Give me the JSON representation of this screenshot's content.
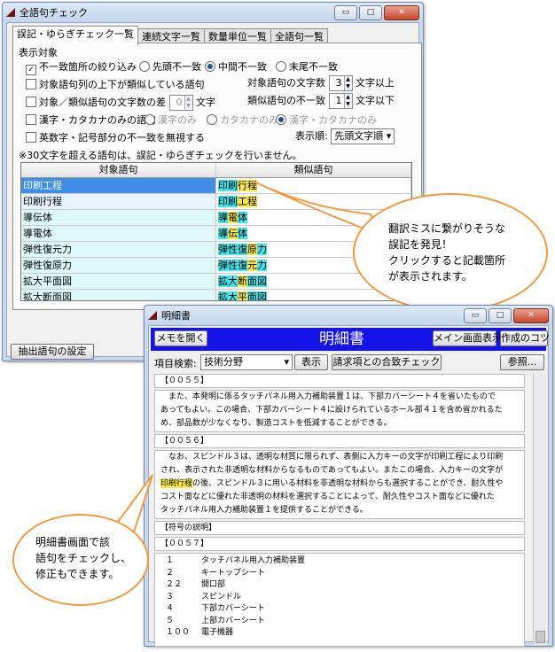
{
  "main_window": {
    "title": "全語句チェック",
    "tabs": [
      "誤記・ゆらぎチェック一覧",
      "連続文字一覧",
      "数量単位一覧",
      "全語句一覧"
    ],
    "group_label": "表示対象",
    "filter_mismatch_label": "不一致箇所の絞り込み",
    "filter_mismatch_checked": "✓",
    "radio_mismatch": [
      "先頭不一致",
      "中間不一致",
      "末尾不一致"
    ],
    "opt_similar_label": "対象語句列の上下が類似している語句",
    "opt_target_len_label": "対象語句の文字数",
    "target_len_value": "3",
    "target_len_suffix": "文字以上",
    "opt_length_diff_label": "対象／類似語句の文字数の差",
    "length_diff_value": "0",
    "length_diff_suffix": "文字",
    "opt_mismatch_count_label": "類似語句の不一致",
    "mismatch_count_value": "1",
    "mismatch_count_suffix": "文字以下",
    "opt_kanji_label": "漢字・カタカナのみの語句",
    "radio_kanji": [
      "漢字のみ",
      "カタカナのみ",
      "漢字・カタカナのみ"
    ],
    "opt_ignore_label": "英数字・記号部分の不一致を無視する",
    "sort_label": "表示順:",
    "sort_value": "先頭文字順",
    "notice": "※30文字を超える語句は、誤記・ゆらぎチェックを行いません。",
    "columns": [
      "対象語句",
      "類似語句"
    ],
    "rows": [
      {
        "target": "印刷工程",
        "sim_a": "印刷",
        "sim_b": "行程",
        "sim_c": ""
      },
      {
        "target": "印刷行程",
        "sim_a": "印刷",
        "sim_b": "工程",
        "sim_c": ""
      },
      {
        "target": "導伝体",
        "sim_a": "導",
        "sim_b": "電",
        "sim_c": "体"
      },
      {
        "target": "導電体",
        "sim_a": "導",
        "sim_b": "伝",
        "sim_c": "体"
      },
      {
        "target": "弾性復元力",
        "sim_a": "弾性復",
        "sim_b": "原",
        "sim_c": "力"
      },
      {
        "target": "弾性復原力",
        "sim_a": "弾性復",
        "sim_b": "元",
        "sim_c": "力"
      },
      {
        "target": "拡大平面図",
        "sim_a": "拡大",
        "sim_b": "断",
        "sim_c": "面図"
      },
      {
        "target": "拡大断面図",
        "sim_a": "拡大",
        "sim_b": "平",
        "sim_c": "面図"
      }
    ],
    "settings_button": "抽出語句の設定"
  },
  "callout_top": {
    "lines": [
      "翻訳ミスに繋がりそうな",
      "誤記を発見！",
      "クリックすると記載箇所",
      "が表示されます。"
    ]
  },
  "spec_window": {
    "title": "明細書",
    "memo_button": "メモを開く",
    "heading": "明細書",
    "main_button": "メイン画面表示",
    "tips_button": "作成のコツ",
    "search_label": "項目検索:",
    "search_value": "技術分野",
    "show_button": "表示",
    "claims_button": "請求項との合致チェック",
    "ref_button": "参照...",
    "sec1": "【００５５】",
    "para1": [
      "　また、本発明に係るタッチパネル用入力補助装置１は、下部カバーシート４を省いたもので",
      "あってもよい。この場合、下部カバーシート４に設けられているホール部４１を含め省かれるた",
      "め、部品数が少なくなり、製造コストを低減することができる。"
    ],
    "sec2": "【００５６】",
    "para2_l1": "　なお、スピンドル３は、透明な材質に限られず、表側に入力キーの文字が印刷工程により印刷",
    "para2_l2": "され、表示された非透明な材料からなるものであってもよい。またこの場合、入力キーの文字が",
    "para2_l3_hl": "印刷行程",
    "para2_l3_rest": "の後、スピンドル３に用いる材料を非透明な材料からも選択することができ、耐久性や",
    "para2_l4": "コスト面などに優れた非透明の材料を選択することによって、耐久性やコスト面などに優れた",
    "para2_l5": "タッチパネル用入力補助装置１を提供することができる。",
    "sec3": "【符号の説明】",
    "sec4": "【００５７】",
    "symbols": [
      {
        "num": "１",
        "label": "タッチパネル用入力補助装置"
      },
      {
        "num": "２",
        "label": "キートップシート"
      },
      {
        "num": "２２",
        "label": "開口部"
      },
      {
        "num": "３",
        "label": "スピンドル"
      },
      {
        "num": "４",
        "label": "下部カバーシート"
      },
      {
        "num": "５",
        "label": "上部カバーシート"
      },
      {
        "num": "１００",
        "label": "電子機器"
      }
    ]
  },
  "callout_bottom": {
    "lines": [
      "明細書画面で該",
      "語句をチェックし、",
      "修正もできます。"
    ]
  },
  "window_buttons": {
    "minimize": "▭",
    "maximize": "□",
    "close": "✕"
  },
  "colors": {
    "highlight_yellow": "#ffe94b",
    "highlight_cyan": "#46e6ee",
    "selected_row": "#3f8de6",
    "callout_border": "#f29a43",
    "spec_bar": "#1414e6"
  }
}
